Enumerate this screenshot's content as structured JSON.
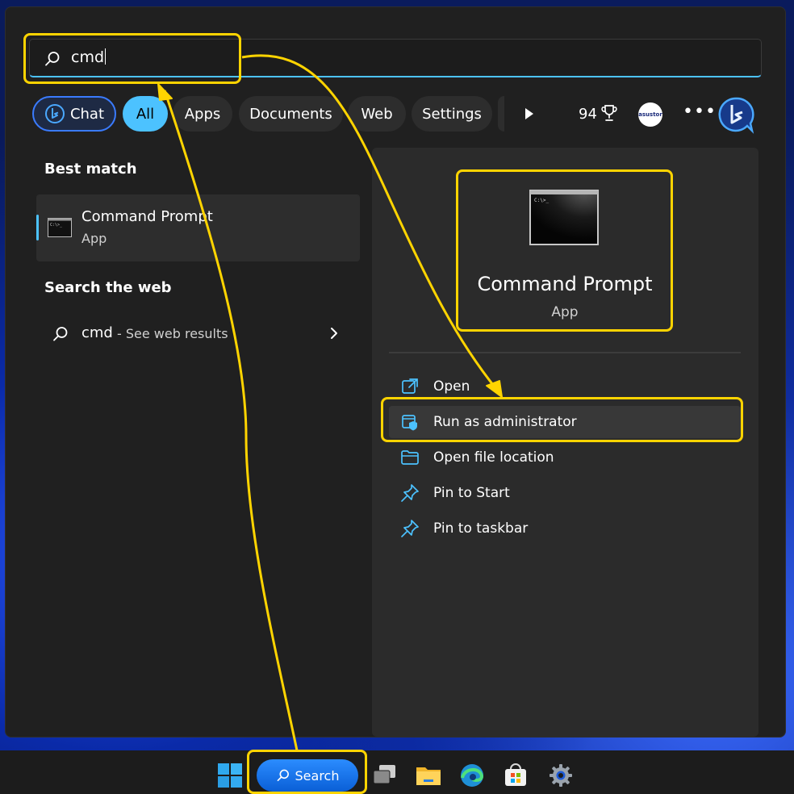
{
  "search": {
    "query": "cmd"
  },
  "filters": [
    {
      "label": "Chat"
    },
    {
      "label": "All"
    },
    {
      "label": "Apps"
    },
    {
      "label": "Documents"
    },
    {
      "label": "Web"
    },
    {
      "label": "Settings"
    }
  ],
  "header": {
    "points": "94",
    "avatar_text": "asustor"
  },
  "best_match": {
    "section_title": "Best match",
    "name": "Command Prompt",
    "type": "App"
  },
  "web": {
    "section_title": "Search the web",
    "term": "cmd",
    "suffix": "- See web results"
  },
  "detail": {
    "name": "Command Prompt",
    "type": "App",
    "actions": [
      {
        "label": "Open",
        "icon": "open-external-icon"
      },
      {
        "label": "Run as administrator",
        "icon": "shield-admin-icon"
      },
      {
        "label": "Open file location",
        "icon": "folder-icon"
      },
      {
        "label": "Pin to Start",
        "icon": "pin-icon"
      },
      {
        "label": "Pin to taskbar",
        "icon": "pin-icon"
      }
    ]
  },
  "taskbar": {
    "search_label": "Search"
  },
  "colors": {
    "accent": "#4cc2ff",
    "highlight": "#ffd400",
    "panel": "#202020",
    "detail_pane": "#2b2b2b"
  }
}
